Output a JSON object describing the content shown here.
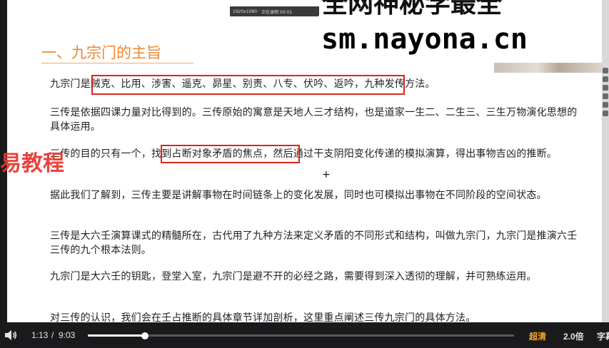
{
  "watermark": {
    "top_text": "全网神秘学最全",
    "url": "sm.nayona.cn",
    "left_text": "易教程"
  },
  "recording_bar": {
    "resolution": "1920x1080",
    "label": "正在录制 00:01"
  },
  "slide": {
    "heading": "一、九宗门的主旨",
    "paragraphs": [
      "九宗门是贼克、比用、涉害、遥克、昴星、别责、八专、伏吟、返吟，九种发传方法。",
      "三传是依据四课力量对比得到的。三传原始的寓意是天地人三才结构，也是道家一生二、二生三、三生万物演化思想的具体运用。",
      "三传的目的只有一个，找到占断对象矛盾的焦点，然后通过干支阴阳变化传递的模拟演算，得出事物吉凶的推断。",
      "据此我们了解到，三传主要是讲解事物在时间链条上的变化发展，同时也可模拟出事物在不同阶段的空间状态。",
      "三传是大六壬演算课式的精髓所在，古代用了九种方法来定义矛盾的不同形式和结构，叫做九宗门，九宗门是推演六壬三传的九个根本法则。",
      "九宗门是大六壬的钥匙，登堂入室，九宗门是避不开的必经之路，需要得到深入透彻的理解，并可熟练运用。",
      "对三传的认识，我们会在壬占推断的具体章节详加剖析，这里重点阐述三传九宗门的具体方法。"
    ]
  },
  "player": {
    "current_time": "1:13",
    "separator": "/",
    "total_time": "9:03",
    "progress": 0.134,
    "quality": "超清",
    "speed": "2.0倍",
    "subtitle": "字幕",
    "accent_color": "#f5a623"
  }
}
